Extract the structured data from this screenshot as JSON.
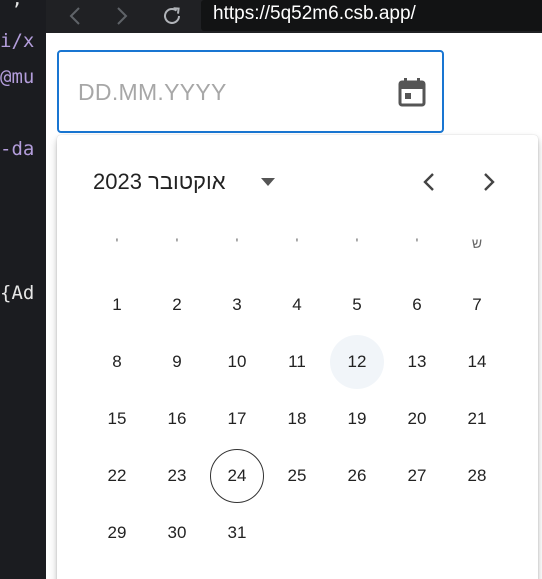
{
  "editor": {
    "lines": [
      {
        "text": "\";",
        "color": "#e6e6e6"
      },
      {
        "text": "i/x",
        "color": "#b39ddb"
      },
      {
        "text": "@mu",
        "color": "#b39ddb"
      },
      {
        "text": "-da",
        "color": "#b39ddb"
      },
      {
        "text": "{Ad",
        "color": "#e6e6e6"
      }
    ]
  },
  "browser": {
    "url": "https://5q52m6.csb.app/"
  },
  "date_field": {
    "placeholder": "DD.MM.YYYY",
    "value": ""
  },
  "calendar": {
    "month_label": "אוקטובר 2023",
    "weekday_headers": [
      "'",
      "'",
      "'",
      "'",
      "'",
      "'",
      "ש"
    ],
    "weeks": [
      [
        "1",
        "2",
        "3",
        "4",
        "5",
        "6",
        "7"
      ],
      [
        "8",
        "9",
        "10",
        "11",
        "12",
        "13",
        "14"
      ],
      [
        "15",
        "16",
        "17",
        "18",
        "19",
        "20",
        "21"
      ],
      [
        "22",
        "23",
        "24",
        "25",
        "26",
        "27",
        "28"
      ],
      [
        "29",
        "30",
        "31"
      ]
    ],
    "hovered_day": "12",
    "today_day": "24"
  },
  "colors": {
    "accent": "#1976d2",
    "toolbar_bg": "#202124",
    "editor_bg": "#1b1c20"
  },
  "icons": {
    "back": "arrow-left-icon",
    "forward": "arrow-right-icon",
    "reload": "reload-icon",
    "calendar": "calendar-icon",
    "month_switch": "caret-down-icon",
    "prev_month": "chevron-left-icon",
    "next_month": "chevron-right-icon"
  }
}
